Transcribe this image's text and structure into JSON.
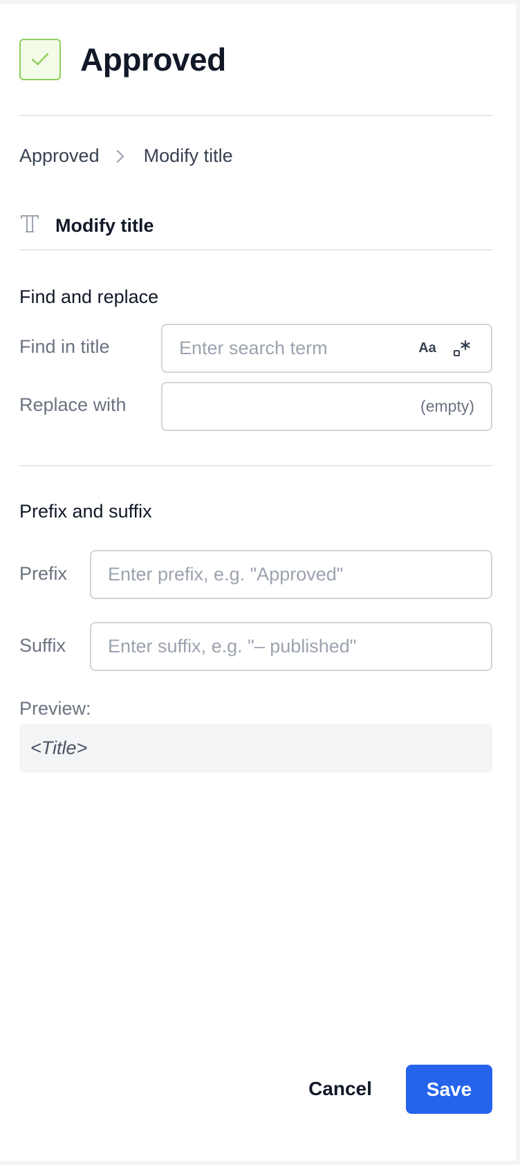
{
  "header": {
    "title": "Approved",
    "status_icon": "check-icon",
    "accent_color": "#8fcf5a"
  },
  "breadcrumb": {
    "items": [
      "Approved",
      "Modify title"
    ],
    "separator_icon": "chevron-right-icon"
  },
  "action": {
    "icon": "text-icon",
    "label": "Modify title"
  },
  "find_replace": {
    "title": "Find and replace",
    "find_label": "Find in title",
    "find_placeholder": "Enter search term",
    "match_case_icon": "match-case-icon",
    "match_case_label": "Aa",
    "regex_icon": "regex-icon",
    "replace_label": "Replace with",
    "replace_hint": "(empty)"
  },
  "prefix_suffix": {
    "title": "Prefix and suffix",
    "prefix_label": "Prefix",
    "prefix_placeholder": "Enter prefix, e.g. \"Approved\"",
    "suffix_label": "Suffix",
    "suffix_placeholder": "Enter suffix, e.g. \"– published\""
  },
  "preview": {
    "label": "Preview:",
    "value": "<Title>"
  },
  "footer": {
    "cancel_label": "Cancel",
    "save_label": "Save",
    "save_color": "#2563eb"
  }
}
